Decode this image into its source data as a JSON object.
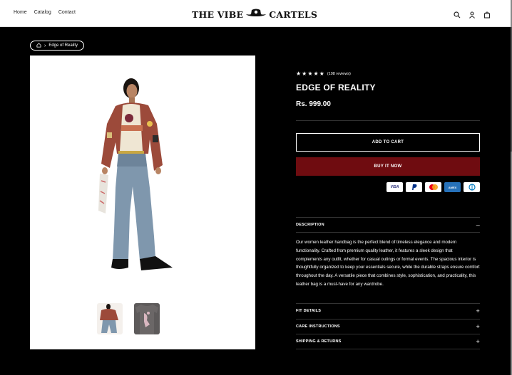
{
  "header": {
    "nav": [
      "Home",
      "Catalog",
      "Contact"
    ],
    "logo_left": "THE VIBE",
    "logo_right": "CARTELS",
    "icons": [
      "search-icon",
      "account-icon",
      "cart-icon"
    ]
  },
  "breadcrumb": {
    "current": "Edge of Reality"
  },
  "product": {
    "rating_stars": "★★★★★",
    "reviews": "(198 reviews)",
    "title": "EDGE OF REALITY",
    "price": "Rs. 999.00",
    "add_to_cart": "ADD TO CART",
    "buy_now": "BUY IT NOW",
    "payments": [
      "VISA",
      "PayPal",
      "Mastercard",
      "AMEX",
      "Diners"
    ],
    "description_label": "DESCRIPTION",
    "description_toggle": "–",
    "description": "Our women leather handbag is the perfect blend of timeless elegance and modern functionality. Crafted from premium quality leather, it features a sleek design that complements any outfit, whether for casual outings or formal events. The spacious interior is thoughtfully organized to keep your essentials secure, while the durable straps ensure comfort throughout the day. A versatile piece that combines style, sophistication, and practicality, this leather bag is a must-have for any wardrobe.",
    "accordions": [
      {
        "label": "FIT DETAILS",
        "toggle": "+"
      },
      {
        "label": "CARE INSTRUCTIONS",
        "toggle": "+"
      },
      {
        "label": "SHIPPING & RETURNS",
        "toggle": "+"
      }
    ]
  },
  "colors": {
    "buy_button": "#6f0c10",
    "background": "#000000"
  }
}
